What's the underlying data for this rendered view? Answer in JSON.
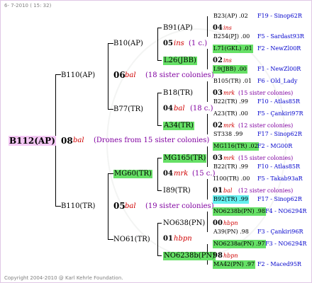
{
  "header": {
    "date": "6- 7-2010 ( 15: 32)"
  },
  "footer": {
    "copyright": "Copyright 2004-2010 @ Karl Kehrle Foundation."
  },
  "root": {
    "id": "B112(AP)",
    "num": "08",
    "tag": "bal",
    "note": "(Drones from 15 sister colonies)"
  },
  "g1": [
    {
      "id": "B110(AP)",
      "num": "06",
      "tag": "bal",
      "note": "(18 sister colonies)"
    },
    {
      "id": "B110(TR)",
      "num": "05",
      "tag": "bal",
      "note": "(19 sister colonies)"
    }
  ],
  "g2": [
    {
      "id": "B10(AP)",
      "num": "05",
      "tag": "ins",
      "note": "(1 c.)"
    },
    {
      "id": "B77(TR)",
      "num": "04",
      "tag": "bal",
      "note": "(18 c.)"
    },
    {
      "id": "MG60(TR)",
      "num": "04",
      "tag": "mrk",
      "note": "(15 c.)"
    },
    {
      "id": "NO61(TR)",
      "num": "01",
      "tag": "hbpn",
      "note": ""
    }
  ],
  "g3": [
    {
      "id": "B91(AP)",
      "num": "04",
      "tag": "ins",
      "note": ""
    },
    {
      "id": "L26(JBB)",
      "num": "02",
      "tag": "ins",
      "note": ""
    },
    {
      "id": "B18(TR)",
      "num": "03",
      "tag": "mrk",
      "note": "(15 sister colonies)"
    },
    {
      "id": "A34(TR)",
      "num": "02",
      "tag": "mrk",
      "note": "(12 sister colonies)"
    },
    {
      "id": "MG165(TR)",
      "num": "03",
      "tag": "mrk",
      "note": "(15 sister colonies)"
    },
    {
      "id": "I89(TR)",
      "num": "01",
      "tag": "bal",
      "note": "(12 sister colonies)"
    },
    {
      "id": "NO638(PN)",
      "num": "00",
      "tag": "hbpn",
      "note": ""
    },
    {
      "id": "NO6238b(PN)",
      "num": "98",
      "tag": "hbpn",
      "note": ""
    }
  ],
  "g4": [
    {
      "id": "B23(AP)",
      "val": ".02",
      "ref": "F19 - Sinop62R"
    },
    {
      "id": "B254(PJ)",
      "val": ".00",
      "ref": "F5 - Sardast93R"
    },
    {
      "id": "L71(GKL)",
      "val": ".01",
      "ref": "F2 - NewZl00R"
    },
    {
      "id": "L9(JBB)",
      "val": ".00",
      "ref": "F1 - NewZl00R"
    },
    {
      "id": "B105(TR)",
      "val": ".01",
      "ref": "F6 - Old_Lady"
    },
    {
      "id": "B22(TR)",
      "val": ".99",
      "ref": "F10 - Atlas85R"
    },
    {
      "id": "A23(TR)",
      "val": ".00",
      "ref": "F5 - Çankiri97R"
    },
    {
      "id": "ST338",
      "val": ".99",
      "ref": "F17 - Sinop62R"
    },
    {
      "id": "MG116(TR)",
      "val": ".02",
      "ref": "F2 - MG00R"
    },
    {
      "id": "B22(TR)",
      "val": ".99",
      "ref": "F10 - Atlas85R"
    },
    {
      "id": "I100(TR)",
      "val": ".00",
      "ref": "F5 - Takab93aR"
    },
    {
      "id": "B92(TR)",
      "val": ".99",
      "ref": "F17 - Sinop62R"
    },
    {
      "id": "NO6238b(PN)",
      "val": ".98",
      "ref": "F4 - NO6294R"
    },
    {
      "id": "A39(PN)",
      "val": ".98",
      "ref": "F3 - Çankiri96R"
    },
    {
      "id": "NO6238a(PN)",
      "val": ".97",
      "ref": "F3 - NO6294R"
    },
    {
      "id": "MA42(PN)",
      "val": ".97",
      "ref": "F2 - Maced95R"
    }
  ]
}
